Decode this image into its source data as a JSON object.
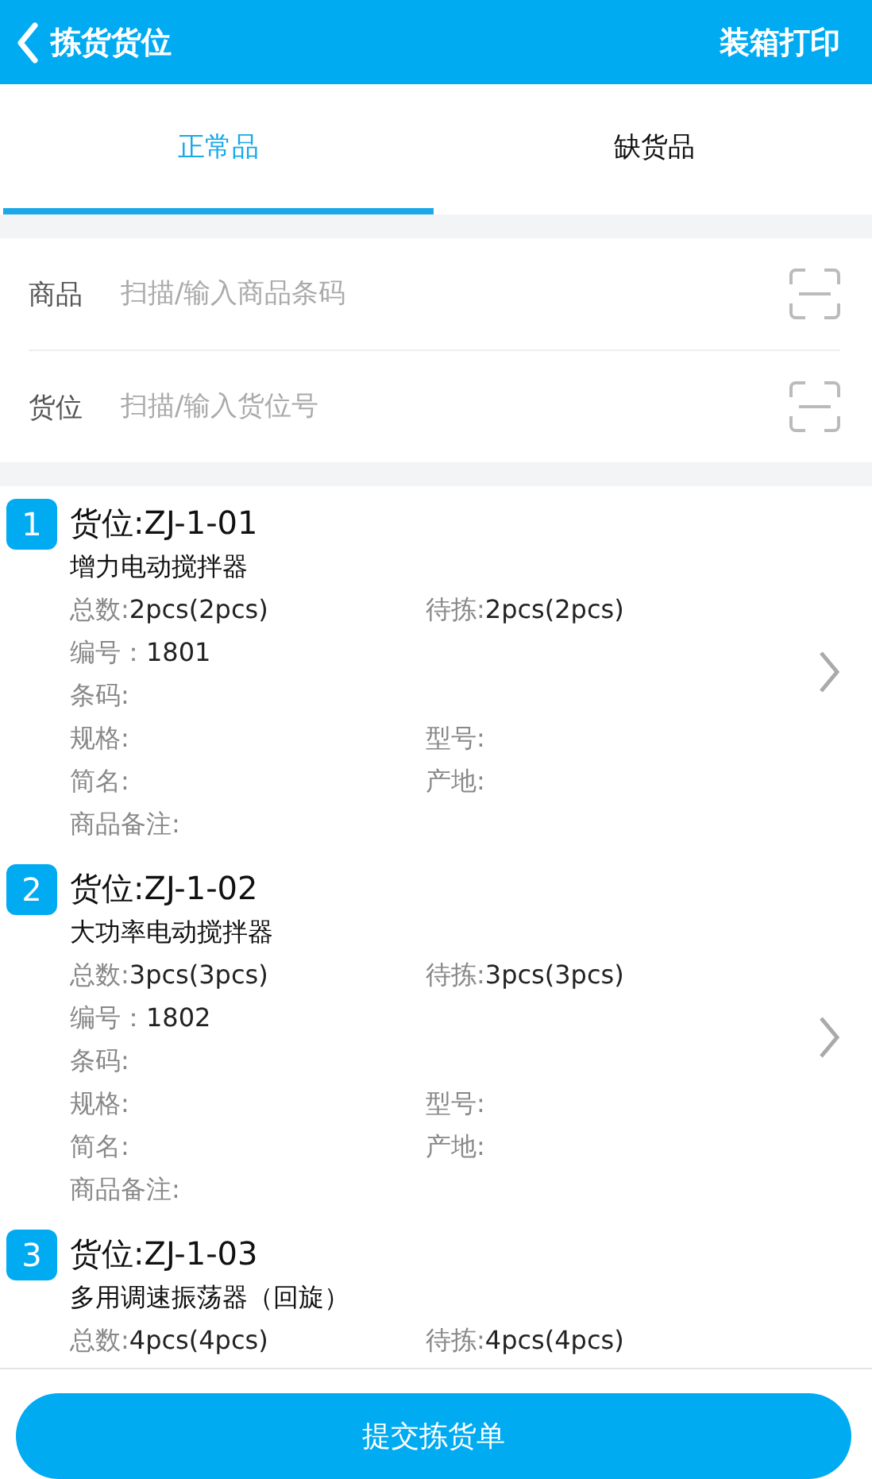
{
  "header": {
    "back_label": "拣货货位",
    "action": "装箱打印"
  },
  "tabs": [
    {
      "label": "正常品",
      "selected": true
    },
    {
      "label": "缺货品",
      "selected": false
    }
  ],
  "scan_fields": [
    {
      "label": "商品",
      "placeholder": "扫描/输入商品条码"
    },
    {
      "label": "货位",
      "placeholder": "扫描/输入货位号"
    }
  ],
  "items": [
    {
      "index": "1",
      "location": "货位:ZJ-1-01",
      "name": "增力电动搅拌器",
      "has_arrow": true,
      "rows": [
        [
          {
            "label": "总数:",
            "value": "2pcs(2pcs)"
          },
          {
            "label": "待拣:",
            "value": "2pcs(2pcs)"
          }
        ],
        [
          {
            "label": "编号：",
            "value": "1801"
          }
        ],
        [
          {
            "label": "条码:"
          }
        ],
        [
          {
            "label": "规格:"
          },
          {
            "label": "型号:"
          }
        ],
        [
          {
            "label": "简名:"
          },
          {
            "label": "产地:"
          }
        ],
        [
          {
            "label": "商品备注:"
          }
        ]
      ]
    },
    {
      "index": "2",
      "location": "货位:ZJ-1-02",
      "name": "大功率电动搅拌器",
      "has_arrow": true,
      "rows": [
        [
          {
            "label": "总数:",
            "value": "3pcs(3pcs)"
          },
          {
            "label": "待拣:",
            "value": "3pcs(3pcs)"
          }
        ],
        [
          {
            "label": "编号：",
            "value": "1802"
          }
        ],
        [
          {
            "label": "条码:"
          }
        ],
        [
          {
            "label": "规格:"
          },
          {
            "label": "型号:"
          }
        ],
        [
          {
            "label": "简名:"
          },
          {
            "label": "产地:"
          }
        ],
        [
          {
            "label": "商品备注:"
          }
        ]
      ]
    },
    {
      "index": "3",
      "location": "货位:ZJ-1-03",
      "name": "多用调速振荡器（回旋）",
      "has_arrow": false,
      "rows": [
        [
          {
            "label": "总数:",
            "value": "4pcs(4pcs)"
          },
          {
            "label": "待拣:",
            "value": "4pcs(4pcs)"
          }
        ]
      ]
    }
  ],
  "submit_button": "提交拣货单"
}
